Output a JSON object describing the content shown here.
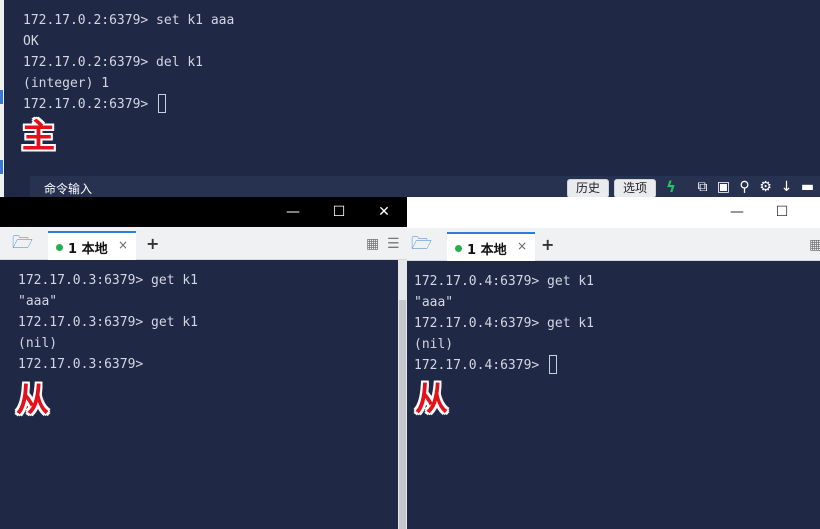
{
  "main": {
    "lines": [
      "172.17.0.2:6379> set k1 aaa",
      "OK",
      "172.17.0.2:6379> del k1",
      "(integer) 1",
      "172.17.0.2:6379> "
    ],
    "role_label": "主",
    "command_bar": {
      "label": "命令输入",
      "history_button": "历史",
      "options_button": "选项"
    }
  },
  "left_window": {
    "controls": {
      "minimize": "—",
      "maximize": "☐",
      "close": "✕"
    },
    "tab": {
      "label": "1 本地",
      "close": "×"
    },
    "new_tab": "+",
    "lines": [
      "172.17.0.3:6379> get k1",
      "\"aaa\"",
      "172.17.0.3:6379> get k1",
      "(nil)",
      "172.17.0.3:6379>"
    ],
    "role_label": "从"
  },
  "right_window": {
    "controls": {
      "minimize": "—",
      "maximize": "☐"
    },
    "tab": {
      "label": "1 本地",
      "close": "×"
    },
    "new_tab": "+",
    "lines": [
      "172.17.0.4:6379> get k1",
      "\"aaa\"",
      "172.17.0.4:6379> get k1",
      "(nil)",
      "172.17.0.4:6379> "
    ],
    "role_label": "从"
  },
  "colors": {
    "terminal_bg": "#1f2845",
    "terminal_text": "#d3d7e3",
    "accent_red": "#e4111b",
    "tab_accent": "#2e7dd7",
    "status_dot": "#22b14c"
  }
}
